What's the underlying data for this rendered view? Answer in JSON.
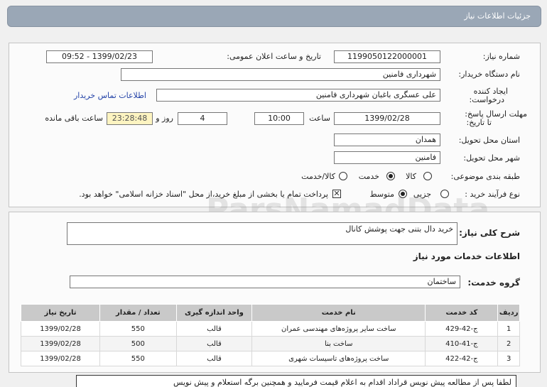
{
  "header": {
    "title": "جزئیات اطلاعات نیاز"
  },
  "need_no": {
    "label": "شماره نیاز:",
    "value": "1199050122000001"
  },
  "announce": {
    "label": "تاریخ و ساعت اعلان عمومی:",
    "value": "1399/02/23 - 09:52"
  },
  "buyer": {
    "label": "نام دستگاه خریدار:",
    "value": "شهرداری فامنین"
  },
  "creator": {
    "label_line1": "ایجاد کننده",
    "label_line2": "درخواست:",
    "value": "علی عسگری باغبان شهرداری فامنین",
    "contact_link": "اطلاعات تماس خریدار"
  },
  "deadline": {
    "label_line1": "مهلت ارسال پاسخ:",
    "label_line2": "تا تاریخ:",
    "date": "1399/02/28",
    "time_label": "ساعت",
    "time": "10:00",
    "days": "4",
    "days_label": "روز و",
    "remaining": "23:28:48",
    "remaining_label": "ساعت باقی مانده"
  },
  "province": {
    "label": "استان محل تحویل:",
    "value": "همدان"
  },
  "city": {
    "label": "شهر محل تحویل:",
    "value": "فامنین"
  },
  "category": {
    "label": "طبقه بندی موضوعی:",
    "options": [
      "کالا",
      "خدمت",
      "کالا/خدمت"
    ],
    "selected": "خدمت"
  },
  "process": {
    "label": "نوع فرآیند خرید :",
    "options": [
      "جزیی",
      "متوسط"
    ],
    "selected": "متوسط",
    "payment_note": "پرداخت تمام یا بخشی از مبلغ خرید،از محل \"اسناد خزانه اسلامی\" خواهد بود."
  },
  "summary": {
    "label": "شرح کلی نیاز:",
    "value": "خرید دال بتنی جهت پوشش کانال"
  },
  "services_title": "اطلاعات خدمات مورد نیاز",
  "service_group": {
    "label": "گروه خدمت:",
    "value": "ساختمان"
  },
  "table": {
    "headers": [
      "ردیف",
      "کد خدمت",
      "نام خدمت",
      "واحد اندازه گیری",
      "تعداد / مقدار",
      "تاریخ نیاز"
    ],
    "rows": [
      [
        "1",
        "ج-42-429",
        "ساخت سایر پروژه‌های مهندسی عمران",
        "قالب",
        "550",
        "1399/02/28"
      ],
      [
        "2",
        "ج-41-410",
        "ساخت بنا",
        "قالب",
        "500",
        "1399/02/28"
      ],
      [
        "3",
        "ج-42-422",
        "ساخت پروژه‌های تاسیسات شهری",
        "قالب",
        "550",
        "1399/02/28"
      ]
    ]
  },
  "note": "لطفا پس از مطالعه پیش نویس قراداد اقدام به اعلام قیمت فرمایید و همچنین برگه استعلام و پیش نویس",
  "watermark": {
    "brand": "ParsNamadData",
    "line_fa1": "مرکز فراوری اطلاعات پارس نماد داده ها",
    "line_fa2": "پایگاه اطلاع رسانی مناقصه ومزایده",
    "phone": "۰۲۱-۸۸۳۴۹۶۷۰-۵"
  }
}
